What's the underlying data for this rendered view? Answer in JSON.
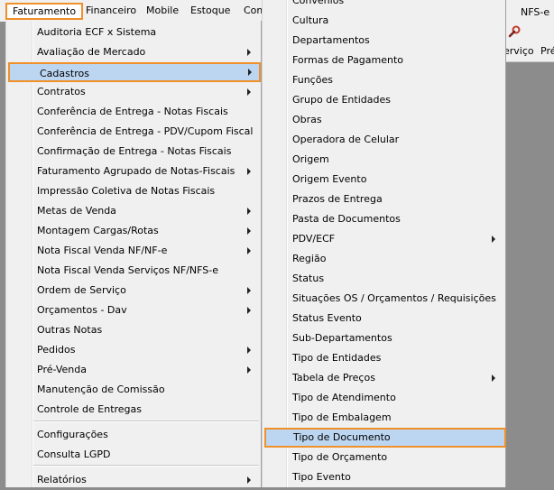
{
  "menubar": {
    "items": [
      {
        "label": "Faturamento"
      },
      {
        "label": "Financeiro"
      },
      {
        "label": "Mobile"
      },
      {
        "label": "Estoque"
      },
      {
        "label": "Com"
      }
    ],
    "right_label": "NFS-e"
  },
  "toolbar": {
    "servico_label": "erviço",
    "pre_label": "Pré",
    "icon": "wrench-icon"
  },
  "faturamento_menu": {
    "items": [
      {
        "label": "Auditoria ECF x Sistema",
        "submenu": false
      },
      {
        "label": "Avaliação de Mercado",
        "submenu": true
      },
      {
        "label": "Cadastros",
        "submenu": true,
        "highlighted": true
      },
      {
        "label": "Contratos",
        "submenu": true
      },
      {
        "label": "Conferência de Entrega - Notas Fiscais",
        "submenu": false
      },
      {
        "label": "Conferência de Entrega - PDV/Cupom Fiscal",
        "submenu": false
      },
      {
        "label": "Confirmação de Entrega - Notas Fiscais",
        "submenu": false
      },
      {
        "label": "Faturamento Agrupado de Notas-Fiscais",
        "submenu": true
      },
      {
        "label": "Impressão Coletiva de Notas Fiscais",
        "submenu": false
      },
      {
        "label": "Metas de Venda",
        "submenu": true
      },
      {
        "label": "Montagem Cargas/Rotas",
        "submenu": true
      },
      {
        "label": "Nota Fiscal Venda NF/NF-e",
        "submenu": true
      },
      {
        "label": "Nota Fiscal Venda Serviços NF/NFS-e",
        "submenu": false
      },
      {
        "label": "Ordem de Serviço",
        "submenu": true
      },
      {
        "label": "Orçamentos - Dav",
        "submenu": true
      },
      {
        "label": "Outras Notas",
        "submenu": false
      },
      {
        "label": "Pedidos",
        "submenu": true
      },
      {
        "label": "Pré-Venda",
        "submenu": true
      },
      {
        "label": "Manutenção de Comissão",
        "submenu": false
      },
      {
        "label": "Controle de Entregas",
        "submenu": false
      },
      {
        "label": "Configurações",
        "submenu": false
      },
      {
        "label": "Consulta LGPD",
        "submenu": false
      },
      {
        "label": "Relatórios",
        "submenu": true
      }
    ]
  },
  "cadastros_menu": {
    "items": [
      {
        "label": "Convênios",
        "submenu": false
      },
      {
        "label": "Cultura",
        "submenu": false
      },
      {
        "label": "Departamentos",
        "submenu": false
      },
      {
        "label": "Formas de Pagamento",
        "submenu": false
      },
      {
        "label": "Funções",
        "submenu": false
      },
      {
        "label": "Grupo de Entidades",
        "submenu": false
      },
      {
        "label": "Obras",
        "submenu": false
      },
      {
        "label": "Operadora de Celular",
        "submenu": false
      },
      {
        "label": "Origem",
        "submenu": false
      },
      {
        "label": "Origem Evento",
        "submenu": false
      },
      {
        "label": "Prazos de Entrega",
        "submenu": false
      },
      {
        "label": "Pasta de Documentos",
        "submenu": false
      },
      {
        "label": "PDV/ECF",
        "submenu": true
      },
      {
        "label": "Região",
        "submenu": false
      },
      {
        "label": "Status",
        "submenu": false
      },
      {
        "label": "Situações OS / Orçamentos / Requisições",
        "submenu": false
      },
      {
        "label": "Status Evento",
        "submenu": false
      },
      {
        "label": "Sub-Departamentos",
        "submenu": false
      },
      {
        "label": "Tipo de Entidades",
        "submenu": false
      },
      {
        "label": "Tabela de Preços",
        "submenu": true
      },
      {
        "label": "Tipo de Atendimento",
        "submenu": false
      },
      {
        "label": "Tipo de Embalagem",
        "submenu": false
      },
      {
        "label": "Tipo de Documento",
        "submenu": false,
        "highlighted": true
      },
      {
        "label": "Tipo de Orçamento",
        "submenu": false
      },
      {
        "label": "Tipo Evento",
        "submenu": false
      }
    ]
  },
  "colors": {
    "highlight_fill": "#bcd6f2",
    "highlight_border": "#f0902a",
    "menu_bg": "#f0f0f0",
    "backdrop": "#8c8c8c"
  }
}
